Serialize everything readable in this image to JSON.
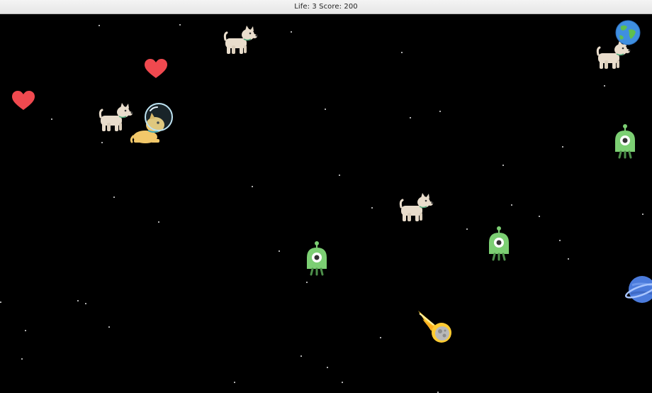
{
  "window": {
    "title": "Life: 3 Score: 200"
  },
  "game": {
    "life": 3,
    "score": 200,
    "background_color": "#000000",
    "sprites": {
      "player": "astronaut-dog-icon",
      "enemies": [
        "dog-icon",
        "dog-icon",
        "dog-icon",
        "dog-icon"
      ],
      "aliens": [
        "alien-icon",
        "alien-icon",
        "alien-icon"
      ],
      "pickups": [
        "heart-icon",
        "heart-icon"
      ],
      "hazards": [
        "comet-icon"
      ],
      "planets": [
        "earth-icon",
        "planet-icon"
      ]
    },
    "colors": {
      "heart": "#f0494f",
      "alien": "#7ccf73",
      "dog": "#e9ddcc",
      "player_dog": "#f2c86a",
      "comet": "#ffcc33",
      "planet": "#4b7bdc"
    }
  }
}
